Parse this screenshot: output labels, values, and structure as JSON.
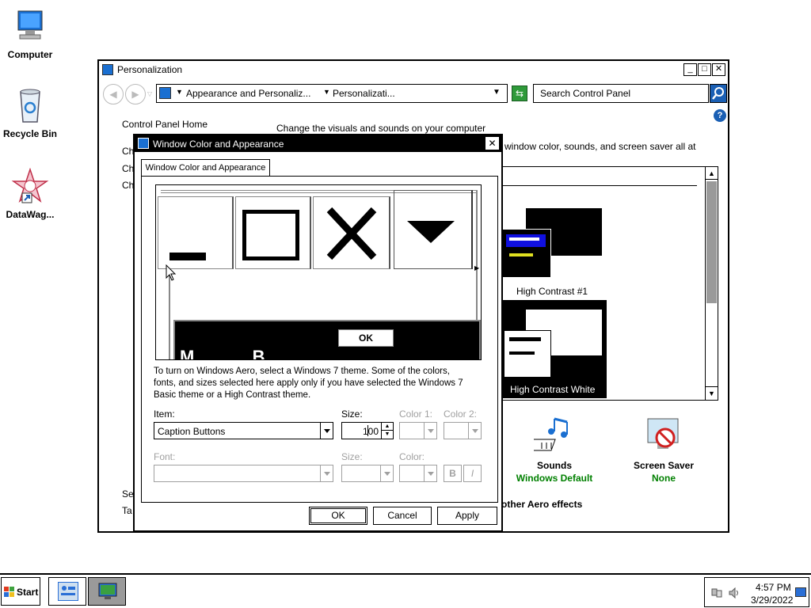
{
  "desktop": {
    "icons": [
      {
        "label": "Computer"
      },
      {
        "label": "Recycle Bin"
      },
      {
        "label": "DataWag..."
      }
    ]
  },
  "personalization": {
    "title": "Personalization",
    "address": {
      "crumb1": "Appearance and Personaliz...",
      "crumb2": "Personalizati..."
    },
    "search_placeholder": "Search Control Panel",
    "sidebar": {
      "home": "Control Panel Home",
      "ch1": "Ch",
      "ch2": "Ch",
      "ch3": "Ch",
      "se": "Se",
      "ta": "Ta"
    },
    "heading": "Change the visuals and sounds on your computer",
    "subtext": "window color, sounds, and screen saver all at",
    "themes": [
      {
        "label": "High Contrast #1"
      },
      {
        "label": "High Contrast White"
      }
    ],
    "sounds": {
      "label": "Sounds",
      "value": "Windows Default"
    },
    "screensaver": {
      "label": "Screen Saver",
      "value": "None"
    },
    "aero_text": "other Aero effects"
  },
  "dialog": {
    "title": "Window Color and Appearance",
    "tab": "Window Color and Appearance",
    "preview_ok": "OK",
    "preview_text": "M            B",
    "info": "To turn on Windows Aero, select a Windows 7 theme.  Some of the colors, fonts, and sizes selected here apply only if you have selected the Windows 7 Basic theme or a High Contrast theme.",
    "item_label": "Item:",
    "item_value": "Caption Buttons",
    "size_label": "Size:",
    "size_value": "100",
    "color1_label": "Color 1:",
    "color2_label": "Color 2:",
    "font_label": "Font:",
    "font_size_label": "Size:",
    "font_color_label": "Color:",
    "bold_label": "B",
    "italic_label": "I",
    "ok": "OK",
    "cancel": "Cancel",
    "apply": "Apply"
  },
  "taskbar": {
    "start": "Start",
    "time": "4:57 PM",
    "date": "3/29/2022"
  }
}
